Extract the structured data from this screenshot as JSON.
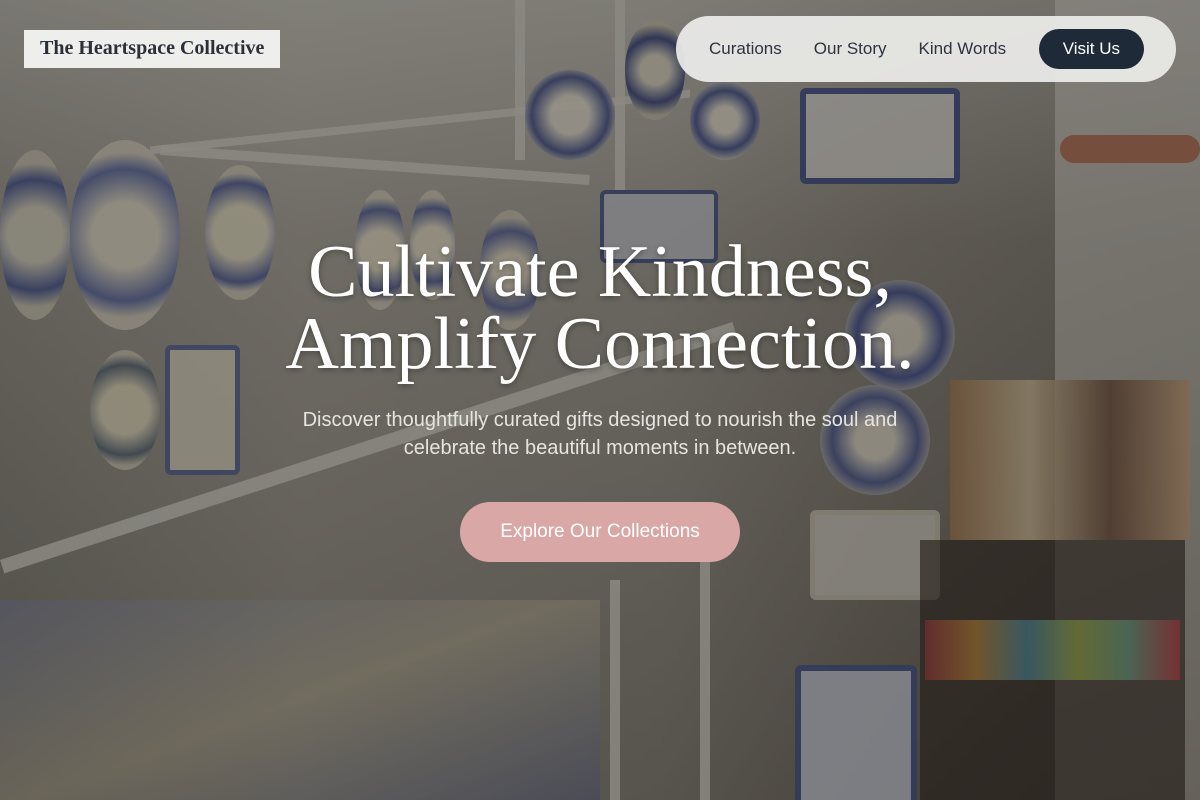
{
  "brand": {
    "name": "The Heartspace Collective"
  },
  "nav": {
    "links": [
      {
        "label": "Curations"
      },
      {
        "label": "Our Story"
      },
      {
        "label": "Kind Words"
      }
    ],
    "cta_label": "Visit Us"
  },
  "hero": {
    "title_line1": "Cultivate Kindness,",
    "title_line2": "Amplify Connection.",
    "subtitle_line1": "Discover thoughtfully curated gifts designed to nourish the soul and",
    "subtitle_line2": "celebrate the beautiful moments in between.",
    "cta_label": "Explore Our Collections"
  },
  "colors": {
    "brand_text": "#2b2f38",
    "nav_cta_bg": "#1f2a38",
    "hero_cta_bg": "#d9a7a6"
  }
}
